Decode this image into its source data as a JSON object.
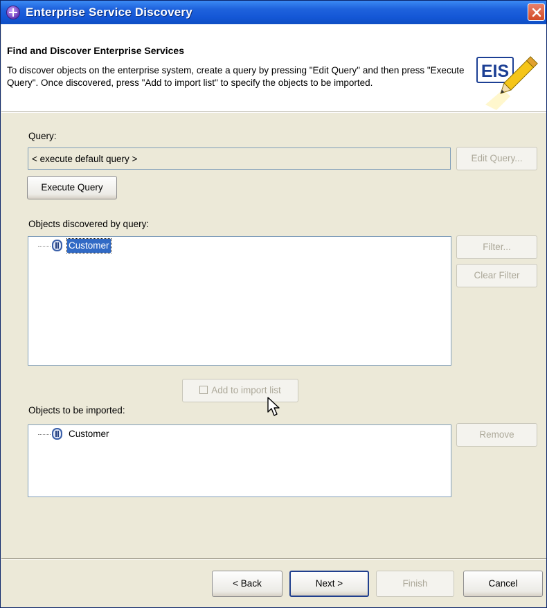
{
  "window": {
    "title": "Enterprise Service Discovery"
  },
  "header": {
    "title": "Find and Discover Enterprise Services",
    "description": "To discover objects on the enterprise system, create a query by pressing \"Edit Query\" and then press \"Execute Query\". Once discovered, press \"Add to import list\" to specify the objects to be imported.",
    "logo_text": "EIS"
  },
  "query": {
    "label": "Query:",
    "value": "< execute default query >",
    "edit_button": "Edit Query...",
    "execute_button": "Execute Query"
  },
  "discovered": {
    "label": "Objects discovered by query:",
    "items": [
      {
        "label": "Customer",
        "selected": true
      }
    ],
    "filter_button": "Filter...",
    "clear_filter_button": "Clear Filter"
  },
  "add_button": "Add to import list",
  "imported": {
    "label": "Objects to be imported:",
    "items": [
      {
        "label": "Customer",
        "selected": false
      }
    ],
    "remove_button": "Remove"
  },
  "footer": {
    "back_button": "< Back",
    "next_button": "Next >",
    "finish_button": "Finish",
    "cancel_button": "Cancel"
  },
  "colors": {
    "title_bar": "#1457d6",
    "dialog_bg": "#ece9d8",
    "selection": "#316ac5",
    "eis_blue": "#1c3f94",
    "pencil_yellow": "#f5c518"
  }
}
